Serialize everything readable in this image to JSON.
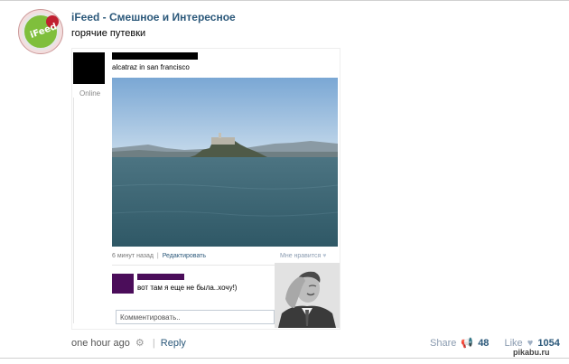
{
  "post": {
    "author": "iFeed - Смешное и Интересное",
    "text": "горячие путевки",
    "avatar_text": "iFeed"
  },
  "screenshot": {
    "online_label": "Online",
    "status_text": "alcatraz in san francisco",
    "meta_time": "6 минут назад",
    "meta_separator": "|",
    "meta_edit": "Редактировать",
    "like_label": "Мне нравится",
    "comment_text": "вот там я еще не была..хочу!)",
    "comment_placeholder": "Комментировать.."
  },
  "footer": {
    "time": "one hour ago",
    "separator": "|",
    "reply": "Reply",
    "share_label": "Share",
    "share_count": "48",
    "like_label": "Like",
    "like_count": "1054"
  },
  "watermark": "pikabu.ru",
  "icons": {
    "gear": "gear-icon",
    "megaphone": "megaphone-icon",
    "heart": "heart-icon"
  },
  "colors": {
    "link": "#2b587a",
    "muted": "#8a9bb0",
    "comment_block": "#4b0d5a"
  }
}
